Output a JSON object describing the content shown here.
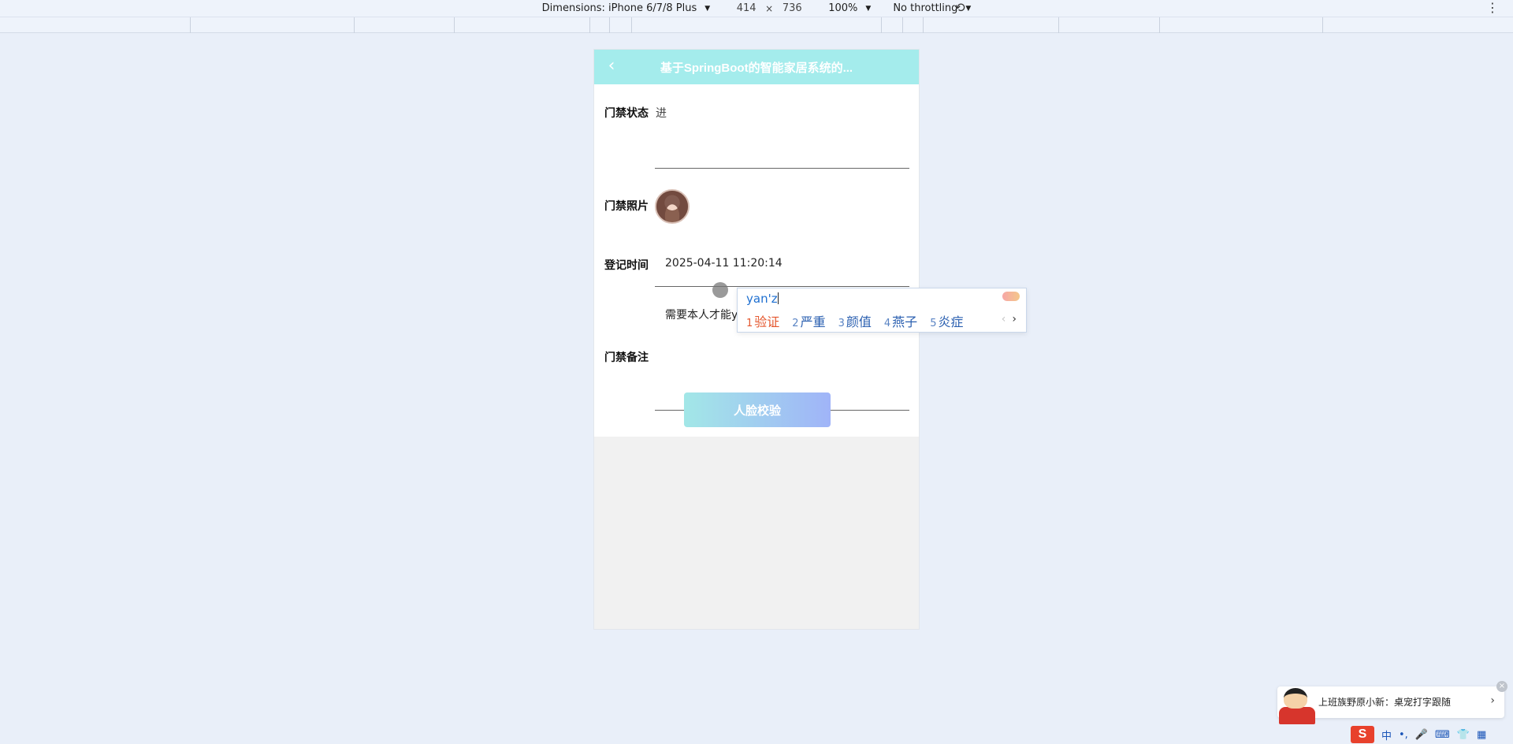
{
  "devtools": {
    "dimensions_label": "Dimensions: iPhone 6/7/8 Plus",
    "width": "414",
    "times": "×",
    "height": "736",
    "zoom": "100%",
    "throttling": "No throttling",
    "rotate_icon": "rotate-icon",
    "more_icon": "more-icon"
  },
  "app": {
    "nav_title": "基于SpringBoot的智能家居系统的...",
    "back_icon": "chevron-left-icon",
    "fields": {
      "status_label": "门禁状态",
      "status_value": "进",
      "photo_label": "门禁照片",
      "time_label": "登记时间",
      "time_value": "2025-04-11 11:20:14",
      "remark_label": "门禁备注",
      "remark_value": "需要本人才能yanz"
    },
    "face_button": "人脸校验"
  },
  "ime": {
    "composition": "yan'z",
    "candidates": [
      {
        "n": "1",
        "text": "验证"
      },
      {
        "n": "2",
        "text": "严重"
      },
      {
        "n": "3",
        "text": "颜值"
      },
      {
        "n": "4",
        "text": "燕子"
      },
      {
        "n": "5",
        "text": "炎症"
      }
    ],
    "next": "›",
    "prev": "‹"
  },
  "notification": {
    "text": "上班族野原小新：桌宠打字跟随",
    "chevron": "›",
    "close": "×"
  },
  "tray": {
    "logo": "S",
    "lang": "中",
    "items": [
      "•,",
      "🎤",
      "⌨",
      "👕",
      "▦"
    ]
  }
}
